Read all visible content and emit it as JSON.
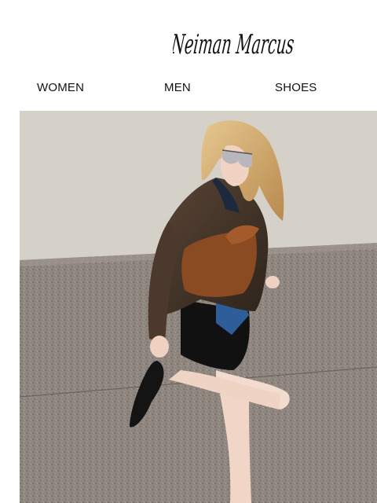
{
  "brand": {
    "logo_text": "Neiman Marcus"
  },
  "nav": {
    "items": [
      {
        "label": "WOMEN"
      },
      {
        "label": "MEN"
      },
      {
        "label": "SHOES"
      }
    ]
  },
  "hero": {
    "image": "fashion-model-photo"
  },
  "colors": {
    "background": "#ffffff",
    "text": "#111111"
  }
}
